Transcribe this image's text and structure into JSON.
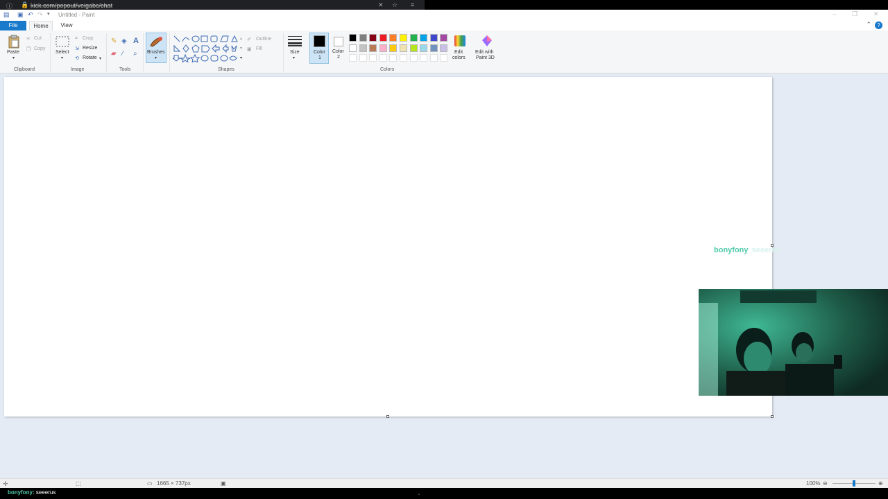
{
  "browser": {
    "url": "kick.com/popout/veigabc/chat"
  },
  "window": {
    "title": "Untitled - Paint"
  },
  "tabs": {
    "file": "File",
    "home": "Home",
    "view": "View",
    "help": "?"
  },
  "ribbon": {
    "clipboard": {
      "paste": "Paste",
      "cut": "Cut",
      "copy": "Copy",
      "group": "Clipboard"
    },
    "image": {
      "select": "Select",
      "crop": "Crop",
      "resize": "Resize",
      "rotate": "Rotate",
      "group": "Image"
    },
    "tools": {
      "group": "Tools"
    },
    "brushes": {
      "label": "Brushes"
    },
    "shapes": {
      "outline": "Outline",
      "fill": "Fill",
      "group": "Shapes"
    },
    "size": {
      "label": "Size"
    },
    "color1": {
      "label": "Color",
      "num": "1"
    },
    "color2": {
      "label": "Color",
      "num": "2"
    },
    "colors": {
      "group": "Colors"
    },
    "edit_colors": {
      "line1": "Edit",
      "line2": "colors"
    },
    "paint3d": {
      "line1": "Edit with",
      "line2": "Paint 3D"
    }
  },
  "palette": {
    "row1": [
      "#000000",
      "#7f7f7f",
      "#880015",
      "#ed1c24",
      "#ff7f27",
      "#fff200",
      "#22b14c",
      "#00a2e8",
      "#3f48cc",
      "#a349a4"
    ],
    "row2": [
      "#ffffff",
      "#c3c3c3",
      "#b97a57",
      "#ffaec9",
      "#ffc90e",
      "#efe4b0",
      "#b5e61d",
      "#99d9ea",
      "#7092be",
      "#c8bfe7"
    ],
    "color1": "#000000",
    "color2": "#ffffff"
  },
  "status": {
    "size": "1665 × 737px",
    "zoom": "100%"
  },
  "overlay": {
    "user": "bonyfony",
    "message": "seeerus"
  },
  "bottom_chat": {
    "user": "bonyfony:",
    "message": " seeerus"
  },
  "colors": {
    "accent": "#1979ca",
    "chat_user": "#4fc9a9",
    "canvas_bg": "#e5ebf4"
  }
}
